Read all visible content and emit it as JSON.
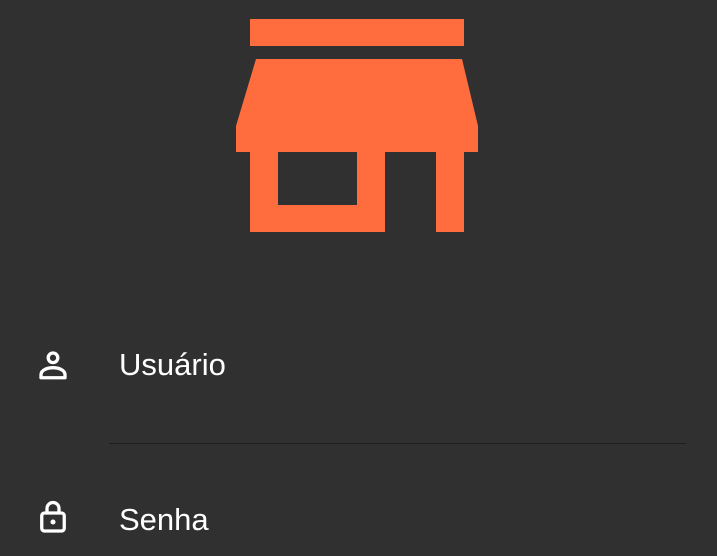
{
  "colors": {
    "background": "#303030",
    "accent": "#ff6d3f",
    "text": "#ffffff",
    "underline": "#1e1e1e"
  },
  "logo": {
    "icon": "storefront-icon"
  },
  "form": {
    "username": {
      "label": "Usuário",
      "value": "",
      "icon": "person-icon"
    },
    "password": {
      "label": "Senha",
      "value": "",
      "icon": "lock-icon"
    }
  }
}
